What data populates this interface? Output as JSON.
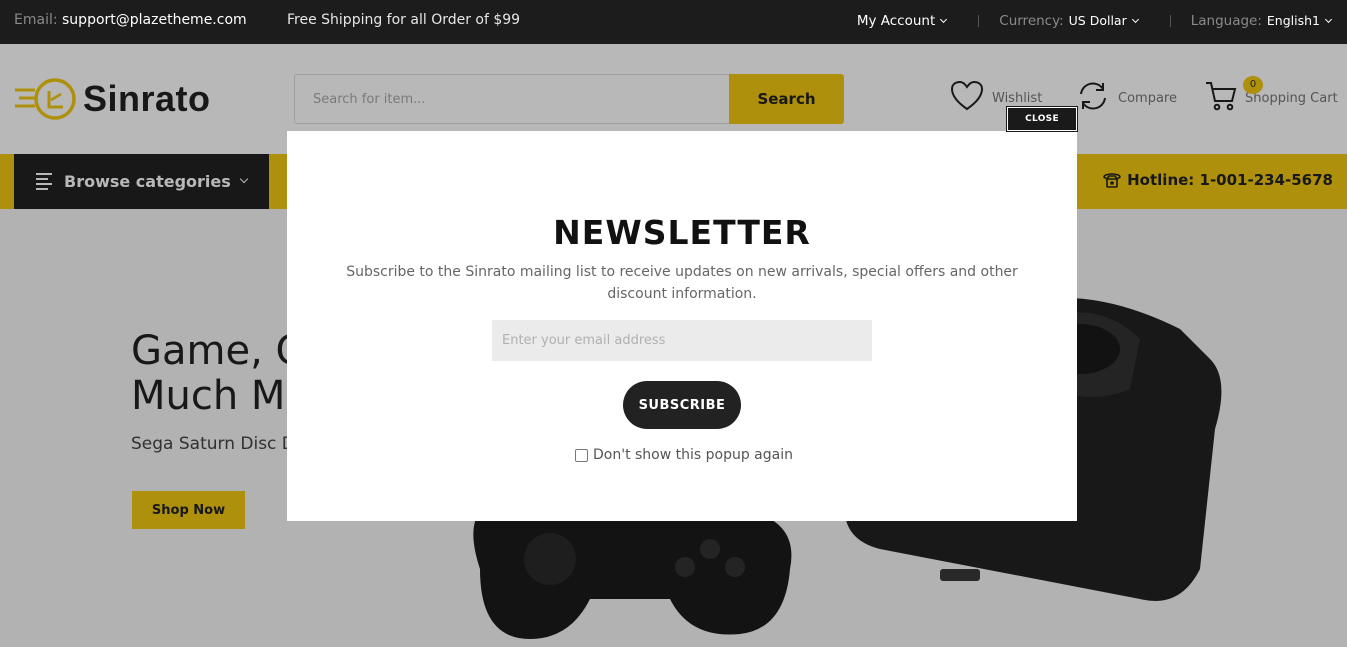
{
  "topbar": {
    "email_label": "Email:",
    "email_value": "support@plazetheme.com",
    "shipping": "Free Shipping for all Order of $99",
    "account": "My Account",
    "currency_label": "Currency:",
    "currency_value": "US Dollar",
    "language_label": "Language:",
    "language_value": "English1"
  },
  "header": {
    "logo_text": "Sinrato",
    "search_placeholder": "Search for item...",
    "search_button": "Search",
    "wishlist": "Wishlist",
    "compare": "Compare",
    "cart": "Shopping Cart",
    "cart_count": "0"
  },
  "nav": {
    "browse": "Browse categories",
    "hotline": "Hotline: 1-001-234-5678"
  },
  "hero": {
    "title_line1": "Game, C",
    "title_line2": "Much M",
    "subtitle": "Sega Saturn Disc D",
    "button": "Shop Now"
  },
  "modal": {
    "close": "CLOSE",
    "title": "NEWSLETTER",
    "description": "Subscribe to the Sinrato mailing list to receive updates on new arrivals, special offers and other discount information.",
    "email_placeholder": "Enter your email address",
    "subscribe": "SUBSCRIBE",
    "dont_show": "Don't show this popup again"
  },
  "colors": {
    "accent": "#f2c811",
    "dark": "#1c1c1c"
  }
}
